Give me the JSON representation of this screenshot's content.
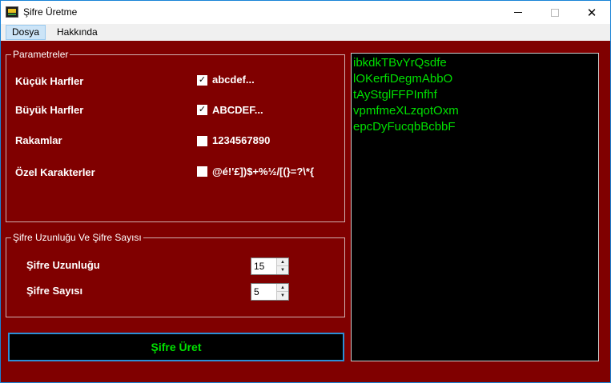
{
  "window": {
    "title": "Şifre Üretme",
    "controls": {
      "minimize": "—",
      "maximize": "☐",
      "close": "✕"
    }
  },
  "menu": {
    "items": [
      {
        "label": "Dosya",
        "active": true
      },
      {
        "label": "Hakkında",
        "active": false
      }
    ]
  },
  "parameters": {
    "legend": "Parametreler",
    "options": [
      {
        "label": "Küçük Harfler",
        "checked": true,
        "sample": "abcdef..."
      },
      {
        "label": "Büyük Harfler",
        "checked": true,
        "sample": "ABCDEF..."
      },
      {
        "label": "Rakamlar",
        "checked": false,
        "sample": "1234567890"
      },
      {
        "label": "Özel Karakterler",
        "checked": false,
        "sample": "@é!'£])$+%½/[(}=?\\*{"
      }
    ]
  },
  "settings": {
    "legend": "Şifre Uzunluğu Ve Şifre Sayısı",
    "length_label": "Şifre Uzunluğu",
    "length_value": "15",
    "count_label": "Şifre Sayısı",
    "count_value": "5"
  },
  "generate_button": {
    "label": "Şifre Üret"
  },
  "output": {
    "passwords": [
      "ibkdkTBvYrQsdfe",
      "lOKerfiDegmAbbO",
      "tAyStglFFPInfhf",
      "vpmfmeXLzqotOxm",
      "epcDyFucqbBcbbF"
    ]
  },
  "colors": {
    "background": "#800000",
    "output_background": "#000000",
    "output_text": "#00e000",
    "button_border": "#2b8fd6"
  }
}
